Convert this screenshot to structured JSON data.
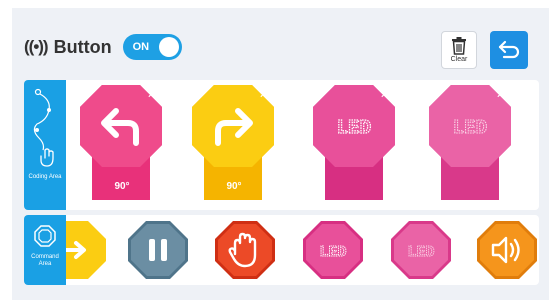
{
  "header": {
    "wave_icon": "((•))",
    "title": "Button",
    "toggle_label": "ON",
    "toggle_on": true,
    "clear_label": "Clear"
  },
  "coding_area": {
    "label": "Coding Area",
    "blocks": [
      {
        "type": "turn-left",
        "color": "#e8317a",
        "angle": "90°",
        "close": "×"
      },
      {
        "type": "turn-right",
        "color": "#f6c100",
        "angle": "90°",
        "close": "×"
      },
      {
        "type": "led",
        "color": "#e0449a",
        "text": "LED",
        "close": "×"
      },
      {
        "type": "led-dim",
        "color": "#e3509e",
        "text": "LED",
        "close": "×"
      }
    ]
  },
  "command_area": {
    "label": "Command Area",
    "items": [
      {
        "type": "turn-right-partial",
        "color": "#f6c100"
      },
      {
        "type": "pause",
        "color": "#5b8197"
      },
      {
        "type": "stop-hand",
        "color": "#e23b1e"
      },
      {
        "type": "led",
        "color": "#e0449a",
        "text": "LED"
      },
      {
        "type": "led-dim",
        "color": "#e3509e",
        "text": "LED"
      },
      {
        "type": "sound",
        "color": "#f39016"
      }
    ]
  },
  "colors": {
    "accent": "#1ea0e4",
    "background": "#eef1f6"
  }
}
